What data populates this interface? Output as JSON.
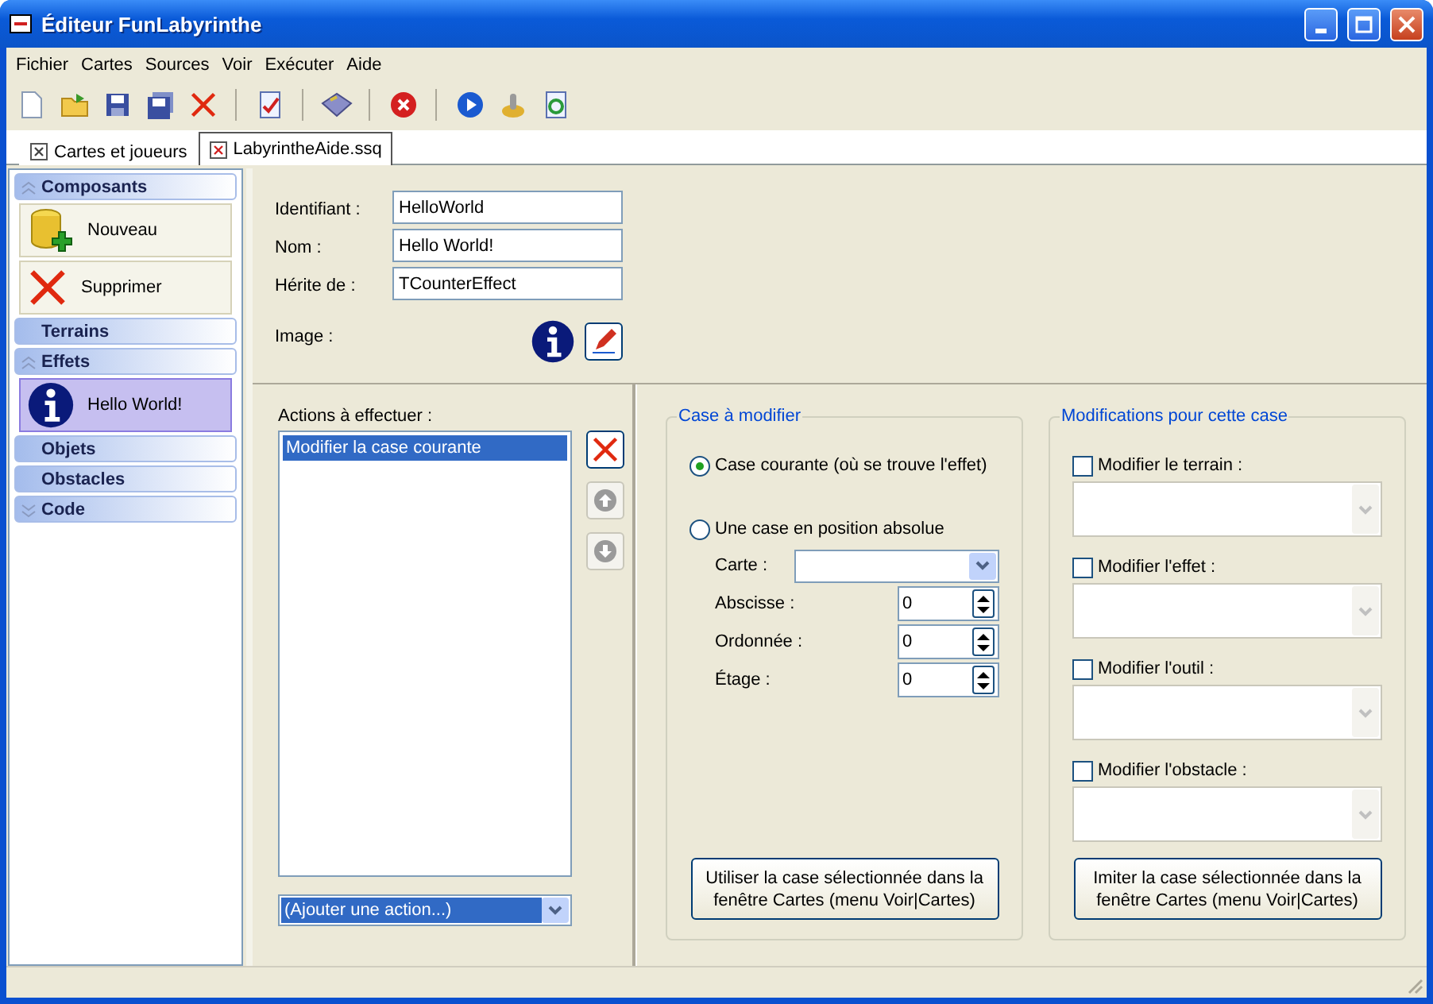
{
  "window": {
    "title": "Éditeur FunLabyrinthe"
  },
  "menu": [
    "Fichier",
    "Cartes",
    "Sources",
    "Voir",
    "Exécuter",
    "Aide"
  ],
  "tabs": [
    {
      "label": "Cartes et joueurs",
      "selected": false
    },
    {
      "label": "LabyrintheAide.ssq",
      "selected": true
    }
  ],
  "sidebar": {
    "groups": [
      {
        "title": "Composants",
        "expanded": true,
        "items": [
          {
            "label": "Nouveau",
            "kind": "add",
            "selected": false
          },
          {
            "label": "Supprimer",
            "kind": "delete",
            "selected": false
          }
        ]
      },
      {
        "title": "Terrains"
      },
      {
        "title": "Effets",
        "expanded": true,
        "items": [
          {
            "label": "Hello World!",
            "kind": "info",
            "selected": true
          }
        ]
      },
      {
        "title": "Objets"
      },
      {
        "title": "Obstacles"
      },
      {
        "title": "Code",
        "expanded": false
      }
    ]
  },
  "form": {
    "fields": [
      {
        "label": "Identifiant :",
        "value": "HelloWorld"
      },
      {
        "label": "Nom :",
        "value": "Hello World!"
      },
      {
        "label": "Hérite de :",
        "value": "TCounterEffect"
      }
    ],
    "image_label": "Image :"
  },
  "actions": {
    "label": "Actions à effectuer :",
    "items": [
      {
        "label": "Modifier la case courante",
        "selected": true
      }
    ],
    "side_buttons": [
      {
        "kind": "delete",
        "disabled": false
      },
      {
        "kind": "up",
        "disabled": true
      },
      {
        "kind": "down",
        "disabled": true
      }
    ],
    "add_dropdown": "(Ajouter une action...)"
  },
  "case_group": {
    "title": "Case à modifier",
    "options": [
      {
        "label": "Case courante (où se trouve l'effet)",
        "selected": true
      },
      {
        "label": "Une case en position absolue",
        "selected": false
      }
    ],
    "carte_label": "Carte :",
    "spins": [
      {
        "label": "Abscisse :",
        "value": "0"
      },
      {
        "label": "Ordonnée :",
        "value": "0"
      },
      {
        "label": "Étage :",
        "value": "0"
      }
    ],
    "button": "Utiliser la case sélectionnée dans la fenêtre Cartes (menu Voir|Cartes)"
  },
  "modifications": {
    "title": "Modifications pour cette case",
    "items": [
      {
        "label": "Modifier le terrain :",
        "checked": false
      },
      {
        "label": "Modifier l'effet :",
        "checked": false
      },
      {
        "label": "Modifier l'outil :",
        "checked": false
      },
      {
        "label": "Modifier l'obstacle :",
        "checked": false
      }
    ],
    "button": "Imiter la case sélectionnée dans la fenêtre Cartes (menu Voir|Cartes)"
  }
}
